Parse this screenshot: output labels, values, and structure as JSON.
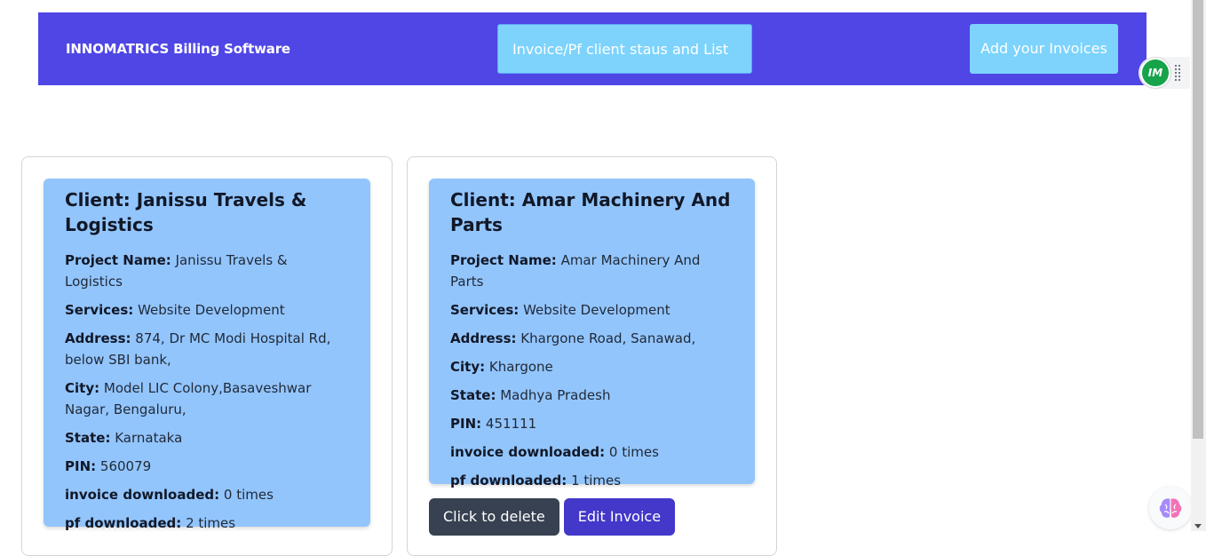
{
  "navbar": {
    "brand": "INNOMATRICS Billing Software",
    "status_button": "Invoice/Pf client staus and List",
    "add_button": "Add your Invoices"
  },
  "extension": {
    "logo_text": "IM"
  },
  "labels": {
    "project_name": "Project Name:",
    "services": "Services:",
    "address": "Address:",
    "city": "City:",
    "state": "State:",
    "pin": "PIN:",
    "invoice_downloaded": "invoice downloaded:",
    "pf_downloaded": "pf downloaded:"
  },
  "clients": [
    {
      "title": "Client: Janissu Travels & Logistics",
      "project_name": "Janissu Travels & Logistics",
      "services": "Website Development",
      "address": "874, Dr MC Modi Hospital Rd, below SBI bank,",
      "city": "Model LIC Colony,Basaveshwar Nagar, Bengaluru,",
      "state": "Karnataka",
      "pin": "560079",
      "invoice_downloaded": "0 times",
      "pf_downloaded": "2 times"
    },
    {
      "title": "Client: Amar Machinery And Parts",
      "project_name": "Amar Machinery And Parts",
      "services": "Website Development",
      "address": "Khargone Road, Sanawad,",
      "city": "Khargone",
      "state": "Madhya Pradesh",
      "pin": "451111",
      "invoice_downloaded": "0 times",
      "pf_downloaded": "1 times",
      "delete_button": "Click to delete",
      "edit_button": "Edit Invoice"
    }
  ],
  "colors": {
    "navbar": "#4f46e5",
    "nav_button": "#7dd3fc",
    "card": "#93c5fd",
    "delete_button": "#374151",
    "edit_button": "#4338ca"
  }
}
